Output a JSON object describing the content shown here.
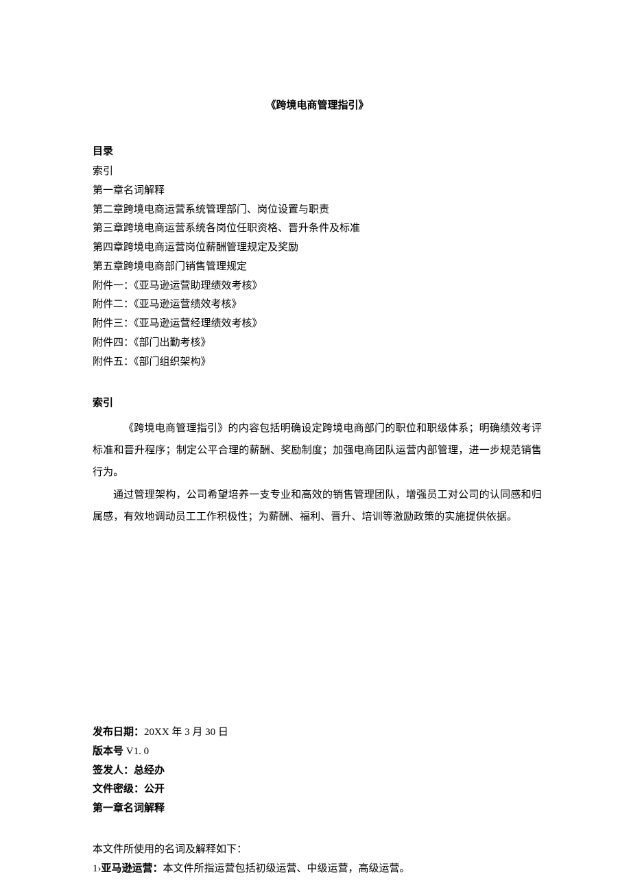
{
  "title": "《跨境电商管理指引》",
  "toc": {
    "header": "目录",
    "items": [
      "索引",
      "第一章名词解释",
      "第二章跨境电商运营系统管理部门、岗位设置与职责",
      "第三章跨境电商运营系统各岗位任职资格、晋升条件及标准",
      "第四章跨境电商运营岗位薪酬管理规定及奖励",
      "第五章跨境电商部门销售管理规定",
      "附件一：《亚马逊运营助理绩效考核》",
      "附件二：《亚马逊运营绩效考核》",
      "附件三：《亚马逊运营经理绩效考核》",
      "附件四：《部门出勤考核》",
      "附件五：《部门组织架构》"
    ]
  },
  "index": {
    "header": "索引",
    "para1": "《跨境电商管理指引》的内容包括明确设定跨境电商部门的职位和职级体系；明确绩效考评标准和晋升程序；制定公平合理的薪酬、奖励制度；加强电商团队运营内部管理，进一步规范销售行为。",
    "para2": "通过管理架构，公司希望培养一支专业和高效的销售管理团队，增强员工对公司的认同感和归属感，有效地调动员工工作积极性；为薪酬、福利、晋升、培训等激励政策的实施提供依据。"
  },
  "footer": {
    "pub_label": "发布日期：",
    "pub_value": "20XX 年 3 月 30 日",
    "version_label": "版本号 ",
    "version_value": "V1. 0",
    "signer_label": "签发人：",
    "signer_value": "总经办",
    "sec_label": "文件密级：",
    "sec_value": "公开",
    "chapter1": "第一章名词解释"
  },
  "defs": {
    "intro": "本文件所使用的名词及解释如下：",
    "item1_prefix": "1›",
    "item1_term": "亚马逊运营：",
    "item1_desc": "本文件所指运营包括初级运营、中级运营，高级运营。"
  }
}
